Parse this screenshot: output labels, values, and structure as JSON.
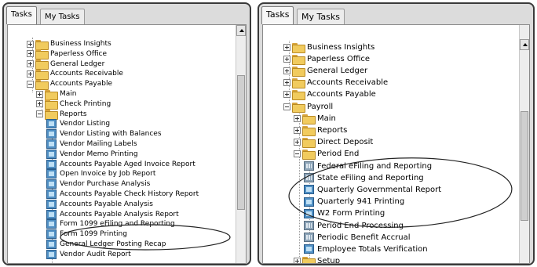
{
  "left_panel": {
    "tabs": [
      {
        "label": "Tasks",
        "active": true
      },
      {
        "label": "My Tasks",
        "active": false
      }
    ],
    "items": [
      {
        "label": "Business Insights",
        "kind": "folder",
        "expander": "plus"
      },
      {
        "label": "Paperless Office",
        "kind": "folder",
        "expander": "plus"
      },
      {
        "label": "General Ledger",
        "kind": "folder",
        "expander": "plus"
      },
      {
        "label": "Accounts Receivable",
        "kind": "folder",
        "expander": "plus"
      },
      {
        "label": "Accounts Payable",
        "kind": "folder",
        "expander": "minus"
      },
      {
        "label": "Main",
        "kind": "folder",
        "expander": "plus"
      },
      {
        "label": "Check Printing",
        "kind": "folder",
        "expander": "plus"
      },
      {
        "label": "Reports",
        "kind": "folder",
        "expander": "minus"
      },
      {
        "label": "Vendor Listing",
        "kind": "report"
      },
      {
        "label": "Vendor Listing with Balances",
        "kind": "report"
      },
      {
        "label": "Vendor Mailing Labels",
        "kind": "report"
      },
      {
        "label": "Vendor Memo Printing",
        "kind": "report"
      },
      {
        "label": "Accounts Payable Aged Invoice Report",
        "kind": "report"
      },
      {
        "label": "Open Invoice by Job Report",
        "kind": "report"
      },
      {
        "label": "Vendor Purchase Analysis",
        "kind": "report"
      },
      {
        "label": "Accounts Payable Check History Report",
        "kind": "report"
      },
      {
        "label": "Accounts Payable Analysis",
        "kind": "report"
      },
      {
        "label": "Accounts Payable Analysis Report",
        "kind": "report"
      },
      {
        "label": "Form 1099 eFiling and Reporting",
        "kind": "report"
      },
      {
        "label": "Form 1099 Printing",
        "kind": "report"
      },
      {
        "label": "General Ledger Posting Recap",
        "kind": "report"
      },
      {
        "label": "Vendor Audit Report",
        "kind": "report"
      }
    ]
  },
  "right_panel": {
    "tabs": [
      {
        "label": "Tasks",
        "active": true
      },
      {
        "label": "My Tasks",
        "active": false
      }
    ],
    "items": [
      {
        "label": "Business Insights",
        "kind": "folder",
        "expander": "plus"
      },
      {
        "label": "Paperless Office",
        "kind": "folder",
        "expander": "plus"
      },
      {
        "label": "General Ledger",
        "kind": "folder",
        "expander": "plus"
      },
      {
        "label": "Accounts Receivable",
        "kind": "folder",
        "expander": "plus"
      },
      {
        "label": "Accounts Payable",
        "kind": "folder",
        "expander": "plus"
      },
      {
        "label": "Payroll",
        "kind": "folder",
        "expander": "minus"
      },
      {
        "label": "Main",
        "kind": "folder",
        "expander": "plus"
      },
      {
        "label": "Reports",
        "kind": "folder",
        "expander": "plus"
      },
      {
        "label": "Direct Deposit",
        "kind": "folder",
        "expander": "plus"
      },
      {
        "label": "Period End",
        "kind": "folder",
        "expander": "minus"
      },
      {
        "label": "Federal eFiling and Reporting",
        "kind": "report-grid"
      },
      {
        "label": "State eFiling and Reporting",
        "kind": "report-grid"
      },
      {
        "label": "Quarterly Governmental Report",
        "kind": "report"
      },
      {
        "label": "Quarterly 941 Printing",
        "kind": "report"
      },
      {
        "label": "W2 Form Printing",
        "kind": "report"
      },
      {
        "label": "Period End Processing",
        "kind": "report-grid"
      },
      {
        "label": "Periodic Benefit Accrual",
        "kind": "report-grid"
      },
      {
        "label": "Employee Totals Verification",
        "kind": "report"
      },
      {
        "label": "Setup",
        "kind": "folder",
        "expander": "plus"
      }
    ]
  },
  "annotation_color": "#222222"
}
